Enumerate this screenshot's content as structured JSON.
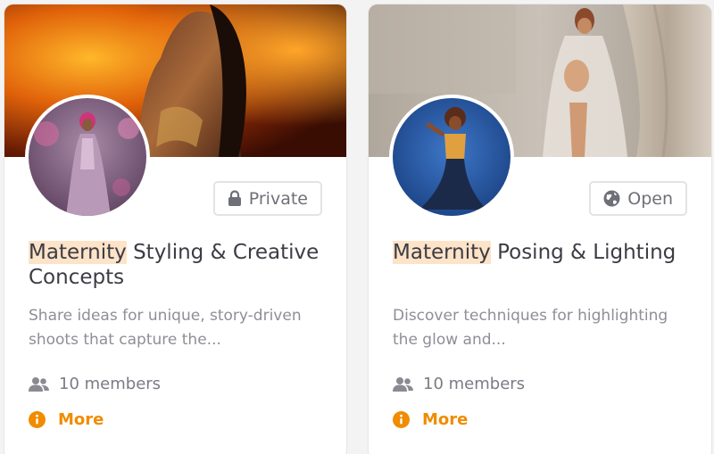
{
  "groups": [
    {
      "title_highlight": "Maternity",
      "title_rest": " Styling & Creative Concepts",
      "access_label": "Private",
      "access_icon": "lock-icon",
      "description": "Share ideas for unique, story-driven shoots that capture the...",
      "members": "10 members",
      "more_label": "More"
    },
    {
      "title_highlight": "Maternity",
      "title_rest": " Posing & Lighting",
      "access_label": "Open",
      "access_icon": "globe-icon",
      "description": "Discover techniques for highlighting the glow and...",
      "members": "10 members",
      "more_label": "More"
    }
  ],
  "colors": {
    "accent": "#f08c00",
    "highlight": "#fde3c8",
    "text": "#3c3c44",
    "muted": "#8e8e96"
  }
}
